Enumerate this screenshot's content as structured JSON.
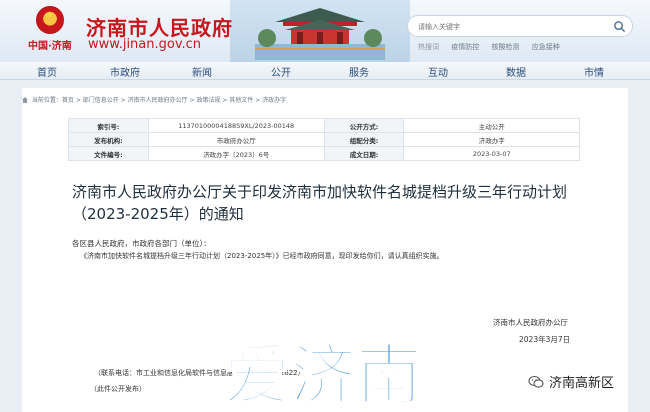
{
  "header": {
    "site_title": "济南市人民政府",
    "site_url": "www.jinan.gov.cn",
    "site_cn": "中国·济南",
    "search_placeholder": "请输入关键字",
    "hot_label": "热搜词",
    "hot_items": [
      "疫情防控",
      "核酸检测",
      "应急接种"
    ]
  },
  "nav": [
    "首页",
    "市政府",
    "新闻",
    "公开",
    "服务",
    "互动",
    "数据",
    "市情"
  ],
  "breadcrumb": "当前位置：首页 > 部门信息公开 > 济南市人民政府办公厅 > 政策法规 > 其他文件 > 济政办字",
  "meta": {
    "index_key": "索引号:",
    "index_val": "11370100004188S9XL/2023-00148",
    "open_mode_key": "公开方式:",
    "open_mode_val": "主动公开",
    "issuer_key": "发布机构:",
    "issuer_val": "市政府办公厅",
    "category_key": "组配分类:",
    "category_val": "济政办字",
    "doc_no_key": "文件编号:",
    "doc_no_val": "济政办字〔2023〕6号",
    "date_key": "成文日期:",
    "date_val": "2023-03-07"
  },
  "doc": {
    "title": "济南市人民政府办公厅关于印发济南市加快软件名城提档升级三年行动计划（2023-2025年）的通知",
    "greeting": "各区县人民政府，市政府各部门（单位）：",
    "body": "《济南市加快软件名城提档升级三年行动计划（2023-2025年）》已经市政府同意，现印发给你们，请认真组织实施。",
    "sign_org": "济南市人民政府办公厅",
    "sign_date": "2023年3月7日",
    "contact": "（联系电话：市工业和信息化局软件与信息服务业处，51702622）",
    "publish": "（此件公开发布）"
  },
  "watermark": "爱济南",
  "wechat_label": "济南高新区",
  "colors": {
    "brand_red": "#c7161d",
    "nav_text": "#2a4d7a",
    "watermark": "#3d8fd6"
  }
}
